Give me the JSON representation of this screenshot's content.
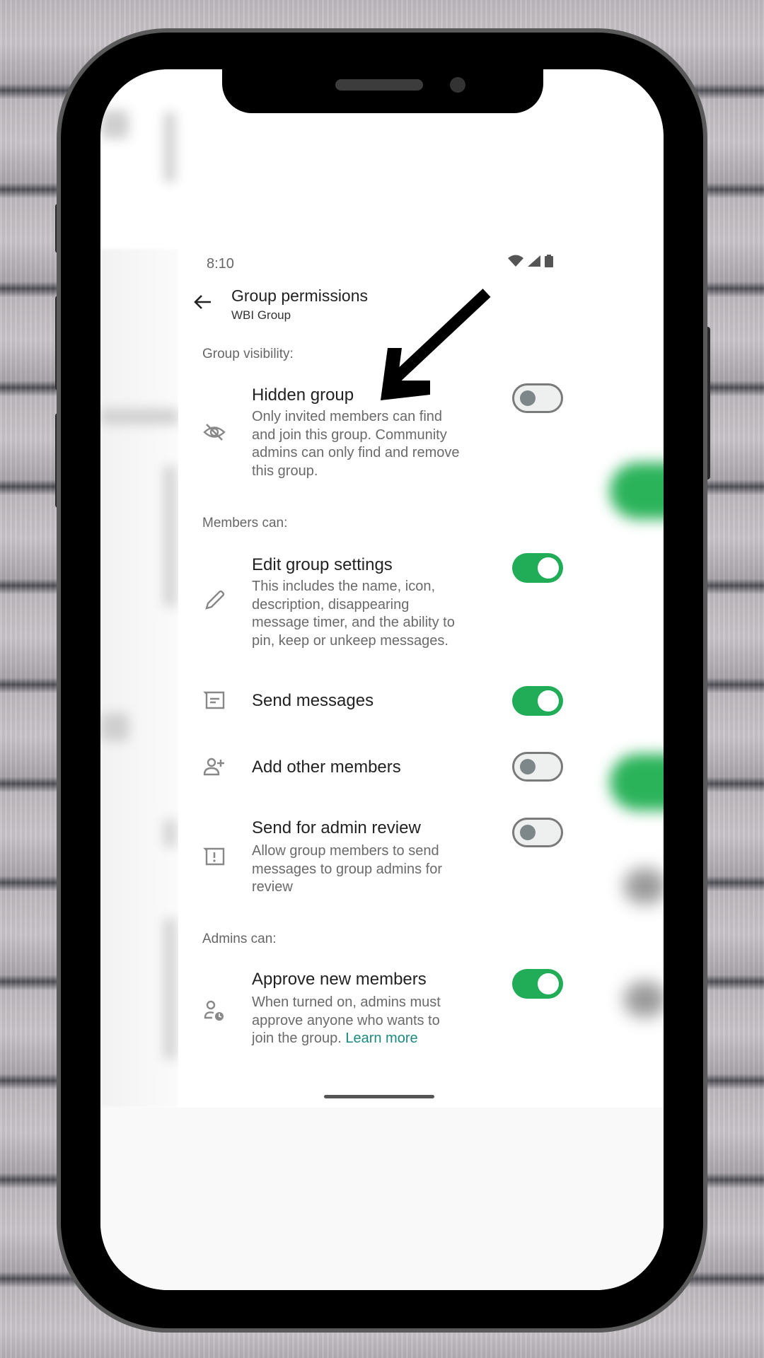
{
  "status_bar": {
    "time": "8:10",
    "icons": [
      "wifi-icon",
      "signal-icon",
      "battery-icon"
    ]
  },
  "header": {
    "title": "Group permissions",
    "subtitle": "WBI Group",
    "back_icon": "back-arrow-icon"
  },
  "sections": [
    {
      "label": "Group visibility:"
    },
    {
      "label": "Members can:"
    },
    {
      "label": "Admins can:"
    }
  ],
  "settings": [
    {
      "icon": "eye-off-icon",
      "title": "Hidden group",
      "description": [
        "Only invited members can find",
        "and join this group. Community",
        "admins can only find and remove",
        "this group."
      ],
      "enabled": false
    },
    {
      "icon": "pencil-icon",
      "title": "Edit group settings",
      "description": [
        "This includes the name, icon,",
        "description, disappearing",
        "message timer, and the ability to",
        "pin, keep or unkeep messages."
      ],
      "enabled": true
    },
    {
      "icon": "message-icon",
      "title": "Send messages",
      "description": [],
      "enabled": true
    },
    {
      "icon": "add-person-icon",
      "title": "Add other members",
      "description": [],
      "enabled": false
    },
    {
      "icon": "report-icon",
      "title": "Send for admin review",
      "description": [
        "Allow group members to send",
        "messages to group admins for",
        "review"
      ],
      "enabled": false
    },
    {
      "icon": "person-clock-icon",
      "title": "Approve new members",
      "description": [
        "When turned on, admins must",
        "approve anyone who wants to",
        "join the group."
      ],
      "link": "Learn more",
      "enabled": true
    }
  ],
  "colors": {
    "toggle_on": "#21ac57",
    "toggle_off_knob": "#7d8688",
    "link": "#1a8a7e"
  },
  "annotation": {
    "arrow_target": "Hidden group"
  }
}
